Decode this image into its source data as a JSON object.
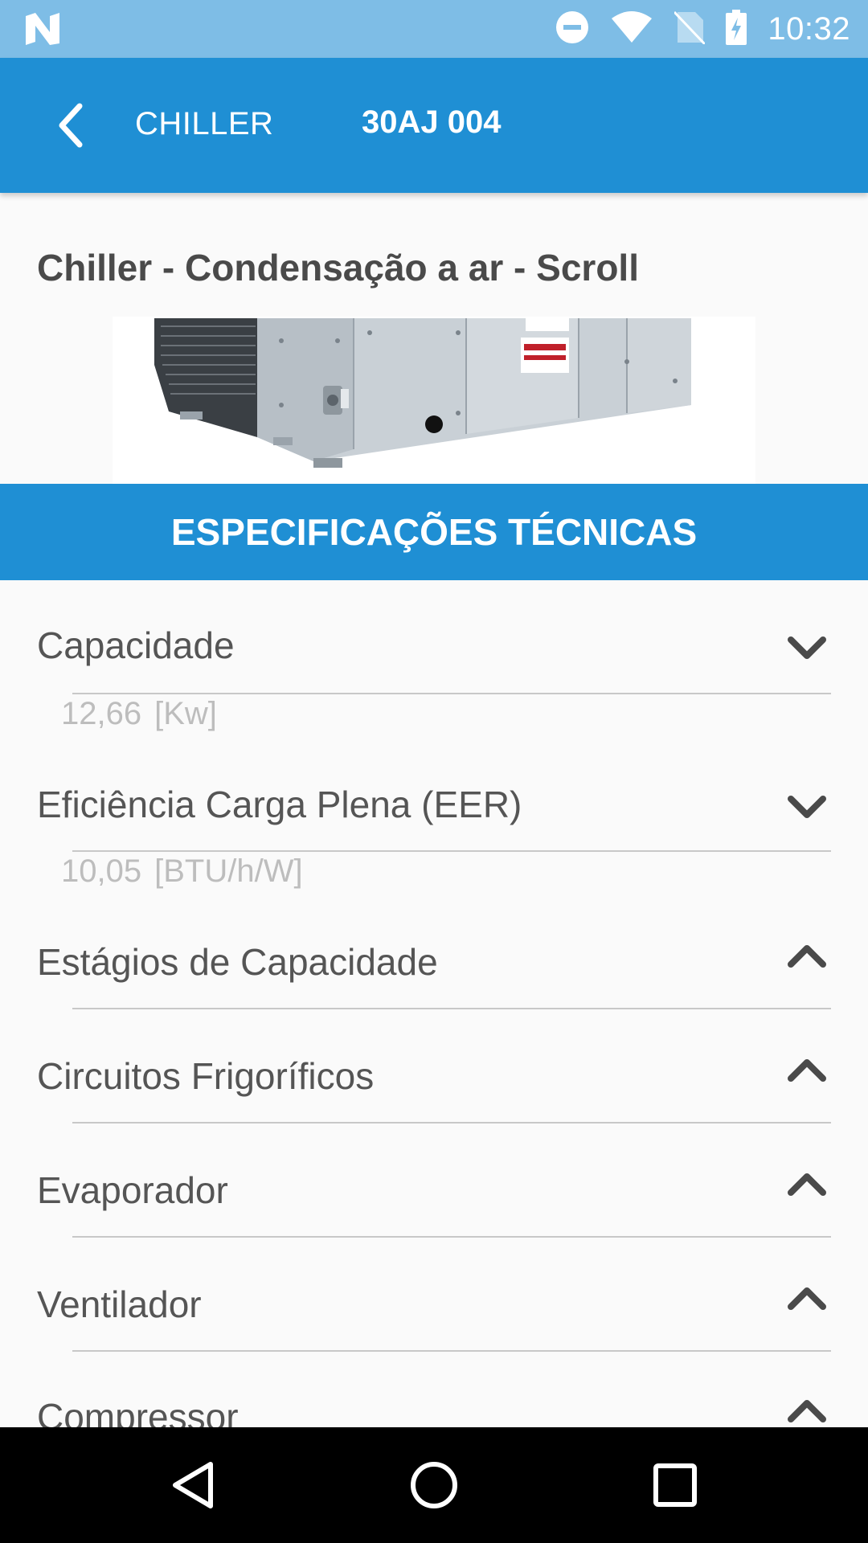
{
  "status_bar": {
    "time": "10:32",
    "icons": [
      "n-notification-icon",
      "do-not-disturb-icon",
      "wifi-icon",
      "no-sim-icon",
      "battery-charging-icon"
    ]
  },
  "app_bar": {
    "back_icon": "chevron-left-icon",
    "breadcrumb": "CHILLER",
    "title": "30AJ 004"
  },
  "product": {
    "title": "Chiller - Condensação a ar - Scroll"
  },
  "section": {
    "title": "ESPECIFICAÇÕES TÉCNICAS"
  },
  "specs": [
    {
      "label": "Capacidade",
      "expanded": true,
      "value": "12,66",
      "unit": "[Kw]"
    },
    {
      "label": "Eficiência Carga Plena (EER)",
      "expanded": true,
      "value": "10,05",
      "unit": "[BTU/h/W]"
    },
    {
      "label": "Estágios de Capacidade",
      "expanded": false
    },
    {
      "label": "Circuitos Frigoríficos",
      "expanded": false
    },
    {
      "label": "Evaporador",
      "expanded": false
    },
    {
      "label": "Ventilador",
      "expanded": false
    },
    {
      "label": "Compressor",
      "expanded": false
    }
  ],
  "colors": {
    "primary": "#1f8fd4",
    "status_bar": "#7ebde6",
    "background": "#fafafa",
    "text": "#555555",
    "value_text": "#bdbdbd"
  }
}
